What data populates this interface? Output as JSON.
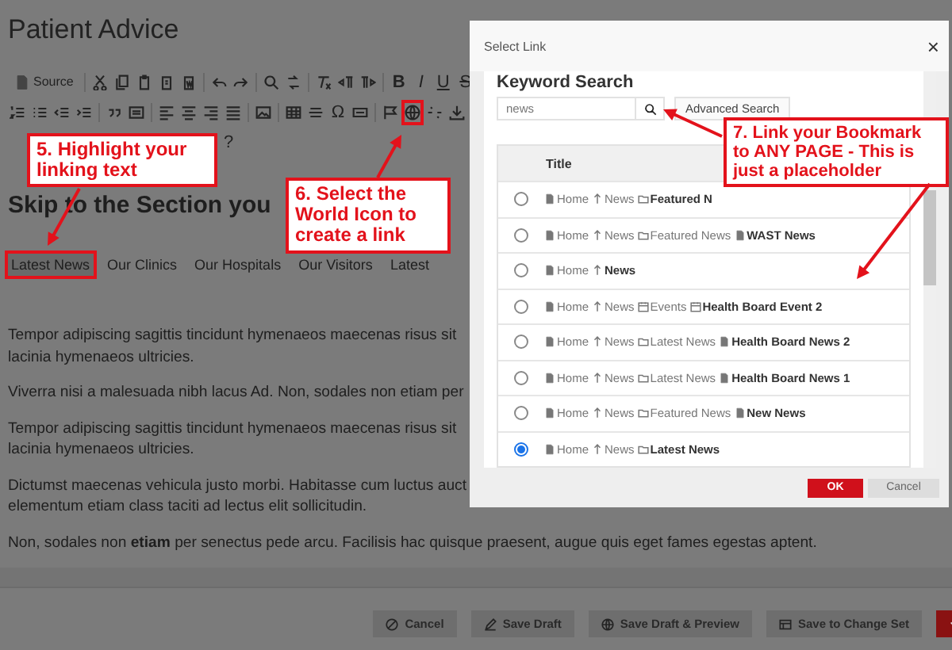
{
  "page": {
    "title": "Patient Advice"
  },
  "toolbar": {
    "rows": [
      [
        {
          "kind": "text",
          "text": "Source"
        },
        {
          "kind": "separator"
        },
        {
          "kind": "icon",
          "marked": false
        },
        {
          "kind": "icon",
          "marked": false
        },
        {
          "kind": "icon",
          "marked": false
        },
        {
          "kind": "icon",
          "marked": false
        },
        {
          "kind": "icon",
          "marked": false
        },
        {
          "kind": "separator"
        },
        {
          "kind": "icon",
          "marked": false
        },
        {
          "kind": "icon",
          "marked": false
        },
        {
          "kind": "separator"
        },
        {
          "kind": "icon",
          "marked": false
        },
        {
          "kind": "icon",
          "marked": false
        },
        {
          "kind": "separator"
        },
        {
          "kind": "icon",
          "marked": false
        },
        {
          "kind": "icon",
          "marked": false
        },
        {
          "kind": "icon",
          "marked": false
        },
        {
          "kind": "separator"
        },
        {
          "kind": "bold",
          "text": "B"
        },
        {
          "kind": "italic",
          "text": "I"
        },
        {
          "kind": "underline",
          "text": "U"
        },
        {
          "kind": "strike",
          "text": "S"
        }
      ],
      [
        {
          "kind": "icon",
          "marked": false
        },
        {
          "kind": "icon",
          "marked": false
        },
        {
          "kind": "icon",
          "marked": false
        },
        {
          "kind": "icon",
          "marked": false
        },
        {
          "kind": "separator"
        },
        {
          "kind": "icon",
          "marked": false
        },
        {
          "kind": "icon",
          "marked": false
        },
        {
          "kind": "separator"
        },
        {
          "kind": "icon",
          "marked": false
        },
        {
          "kind": "icon",
          "marked": false
        },
        {
          "kind": "icon",
          "marked": false
        },
        {
          "kind": "icon",
          "marked": false
        },
        {
          "kind": "separator"
        },
        {
          "kind": "icon",
          "marked": false
        },
        {
          "kind": "separator"
        },
        {
          "kind": "icon",
          "marked": false
        },
        {
          "kind": "icon",
          "marked": false
        },
        {
          "kind": "glyph",
          "text": "Ω"
        },
        {
          "kind": "icon",
          "marked": false
        },
        {
          "kind": "separator"
        },
        {
          "kind": "icon",
          "marked": false
        },
        {
          "kind": "icon",
          "marked": true
        },
        {
          "kind": "icon",
          "marked": false
        },
        {
          "kind": "icon",
          "marked": false
        }
      ],
      [
        {
          "kind": "glyph",
          "text": "?"
        }
      ]
    ]
  },
  "heading": "Skip to the Section you",
  "nav": [
    {
      "label": "Latest News",
      "selected": true
    },
    {
      "label": "Our Clinics",
      "selected": false
    },
    {
      "label": "Our Hospitals",
      "selected": false
    },
    {
      "label": "Our Visitors",
      "selected": false
    },
    {
      "label": "Latest",
      "selected": false
    }
  ],
  "paragraphs": [
    {
      "lines": [
        "Tempor adipiscing sagittis tincidunt hymenaeos maecenas risus sit",
        "lacinia hymenaeos ultricies."
      ]
    },
    {
      "lines": [
        "Viverra nisi a malesuada nibh lacus Ad. Non, sodales non etiam per"
      ]
    },
    {
      "lines": [
        "Tempor adipiscing sagittis tincidunt hymenaeos maecenas risus sit",
        "lacinia hymenaeos ultricies."
      ]
    },
    {
      "lines": [
        "Dictumst maecenas vehicula justo morbi. Habitasse cum luctus auct",
        "elementum etiam class taciti ad lectus elit sollicitudin."
      ]
    },
    {
      "lines": [
        "Non, sodales non **etiam** per senectus pede arcu. Facilisis hac quisque praesent, augue quis eget fames egestas aptent."
      ]
    }
  ],
  "actions": [
    {
      "kind": "default",
      "label": "Cancel"
    },
    {
      "kind": "default",
      "label": "Save Draft"
    },
    {
      "kind": "default",
      "label": "Save Draft & Preview"
    },
    {
      "kind": "default",
      "label": "Save to Change Set"
    },
    {
      "kind": "primary"
    }
  ],
  "modal": {
    "title": "Select Link",
    "close": "×",
    "section": "Keyword Search",
    "search": {
      "value": "news"
    },
    "advanced": "Advanced Search",
    "column": "Title",
    "rows": [
      {
        "selected": false,
        "crumbs": [
          {
            "kind": "page",
            "text": "Home"
          },
          {
            "kind": "branch",
            "text": "News"
          },
          {
            "kind": "folder",
            "text": "Featured N"
          }
        ]
      },
      {
        "selected": false,
        "crumbs": [
          {
            "kind": "page",
            "text": "Home"
          },
          {
            "kind": "branch",
            "text": "News"
          },
          {
            "kind": "folder",
            "text": "Featured News"
          },
          {
            "kind": "page",
            "text": "WAST News"
          }
        ]
      },
      {
        "selected": false,
        "crumbs": [
          {
            "kind": "page",
            "text": "Home"
          },
          {
            "kind": "branch",
            "text": "News"
          }
        ]
      },
      {
        "selected": false,
        "crumbs": [
          {
            "kind": "page",
            "text": "Home"
          },
          {
            "kind": "branch",
            "text": "News"
          },
          {
            "kind": "calendar",
            "text": "Events"
          },
          {
            "kind": "calendar",
            "text": "Health Board Event 2"
          }
        ]
      },
      {
        "selected": false,
        "crumbs": [
          {
            "kind": "page",
            "text": "Home"
          },
          {
            "kind": "branch",
            "text": "News"
          },
          {
            "kind": "folder",
            "text": "Latest News"
          },
          {
            "kind": "page",
            "text": "Health Board News 2"
          }
        ]
      },
      {
        "selected": false,
        "crumbs": [
          {
            "kind": "page",
            "text": "Home"
          },
          {
            "kind": "branch",
            "text": "News"
          },
          {
            "kind": "folder",
            "text": "Latest News"
          },
          {
            "kind": "page",
            "text": "Health Board News 1"
          }
        ]
      },
      {
        "selected": false,
        "crumbs": [
          {
            "kind": "page",
            "text": "Home"
          },
          {
            "kind": "branch",
            "text": "News"
          },
          {
            "kind": "folder",
            "text": "Featured News"
          },
          {
            "kind": "page",
            "text": "New News"
          }
        ]
      },
      {
        "selected": true,
        "crumbs": [
          {
            "kind": "page",
            "text": "Home"
          },
          {
            "kind": "branch",
            "text": "News"
          },
          {
            "kind": "folder",
            "text": "Latest News"
          }
        ]
      }
    ],
    "buttons": [
      {
        "kind": "primary",
        "label": "OK"
      },
      {
        "kind": "default",
        "label": "Cancel"
      }
    ]
  },
  "callouts": [
    {
      "text": "5. Highlight your linking text"
    },
    {
      "text": "6. Select the World Icon to create a link"
    },
    {
      "text": "7. Link your Bookmark to ANY PAGE - This is just a placeholder"
    }
  ]
}
